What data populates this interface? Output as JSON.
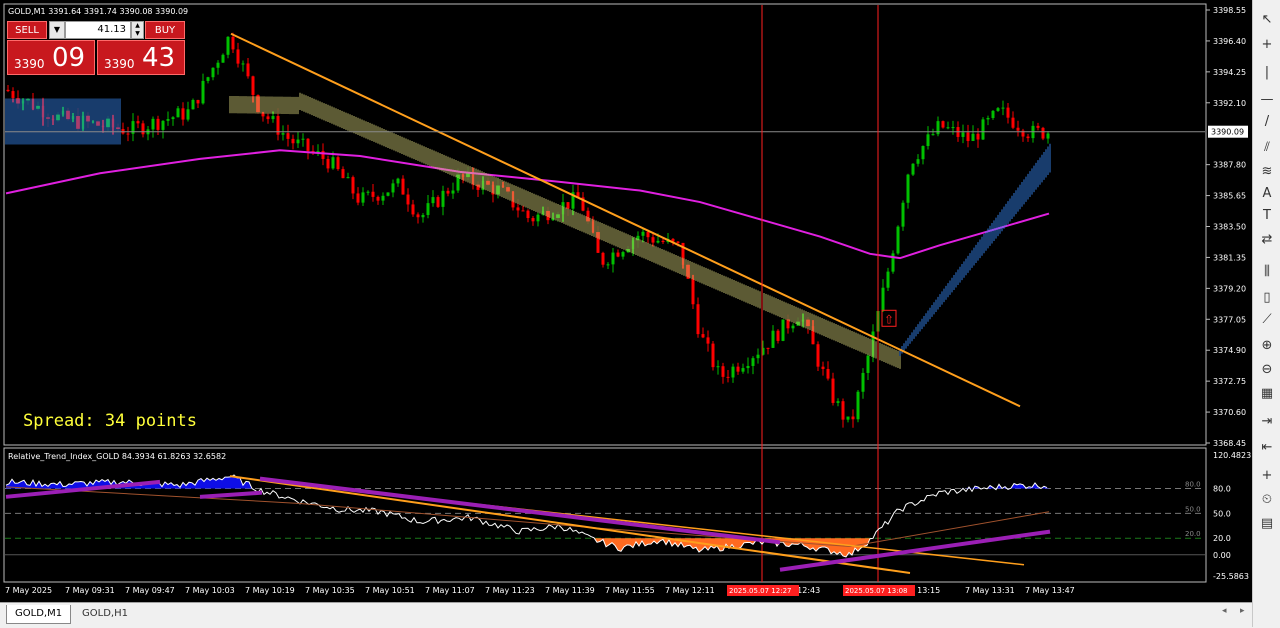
{
  "chart": {
    "title": "GOLD,M1  3391.64 3391.74 3390.08 3390.09",
    "current_price_label": "3390.09",
    "spread_text": "Spread: 34 points",
    "price_axis": [
      "3398.55",
      "3396.40",
      "3394.25",
      "3392.10",
      "3387.80",
      "3385.65",
      "3383.50",
      "3381.35",
      "3379.20",
      "3377.05",
      "3374.90",
      "3372.75",
      "3370.60",
      "3368.45"
    ],
    "time_axis": [
      "7 May 2025",
      "7 May 09:31",
      "7 May 09:47",
      "7 May 10:03",
      "7 May 10:19",
      "7 May 10:35",
      "7 May 10:51",
      "7 May 11:07",
      "7 May 11:23",
      "7 May 11:39",
      "7 May 11:55",
      "7 May 12:11",
      "",
      "ay 12:43",
      "",
      "ay 13:15",
      "7 May 13:31",
      "7 May 13:47"
    ],
    "time_markers": [
      "2025.05.07 12:27",
      "2025.05.07 13:08"
    ]
  },
  "trade_panel": {
    "sell_label": "SELL",
    "buy_label": "BUY",
    "volume": "41.13",
    "bid_small": "3390",
    "bid_big": "09",
    "ask_small": "3390",
    "ask_big": "43"
  },
  "indicator": {
    "title": "Relative_Trend_Index_GOLD 84.3934 61.8263 32.6582",
    "axis": [
      "120.4823",
      "80.0",
      "50.0",
      "20.0",
      "0.00",
      "-25.5863"
    ]
  },
  "tabs": [
    {
      "label": "GOLD,M1",
      "active": true
    },
    {
      "label": "GOLD,H1",
      "active": false
    }
  ],
  "toolbar_icons": [
    "cursor-icon",
    "crosshair-icon",
    "vertical-line-icon",
    "horizontal-line-icon",
    "trendline-icon",
    "channel-icon",
    "fibonacci-icon",
    "text-icon",
    "label-icon",
    "arrows-icon",
    "bar-chart-icon",
    "candlestick-icon",
    "line-chart-icon",
    "zoom-in-icon",
    "zoom-out-icon",
    "tile-windows-icon",
    "autoscroll-icon",
    "chart-shift-icon",
    "indicators-icon",
    "periods-icon",
    "templates-icon"
  ],
  "colors": {
    "background": "#000000",
    "bull_candle": "#00c000",
    "bear_candle": "#ff0000",
    "ma_magenta": "#e020e0",
    "trendline": "#ff9f1c",
    "sell_panel": "#c8181e",
    "spread_text": "#ffff3a",
    "rti_blue": "#1010ff",
    "rti_orange": "#ff6a20",
    "ichimoku_blue": "#3a8cff"
  }
}
